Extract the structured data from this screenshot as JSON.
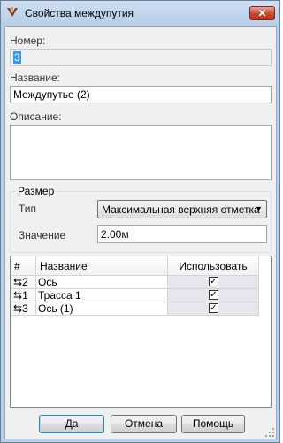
{
  "window": {
    "title": "Свойства междупутия",
    "close_label": "✕"
  },
  "form": {
    "number_label": "Номер:",
    "number_value": "3",
    "name_label": "Название:",
    "name_value": "Междупутье (2)",
    "description_label": "Описание:",
    "description_value": ""
  },
  "size_group": {
    "title": "Размер",
    "type_label": "Тип",
    "type_value": "Максимальная верхняя отметка",
    "value_label": "Значение",
    "value_value": "2.00м"
  },
  "table": {
    "headers": [
      "#",
      "Название",
      "Использовать"
    ],
    "rows": [
      {
        "id": "2",
        "name": "Ось",
        "use": true
      },
      {
        "id": "1",
        "name": "Трасса 1",
        "use": true
      },
      {
        "id": "3",
        "name": "Ось (1)",
        "use": true
      }
    ]
  },
  "buttons": {
    "ok": "Да",
    "cancel": "Отмена",
    "help": "Помощь"
  }
}
